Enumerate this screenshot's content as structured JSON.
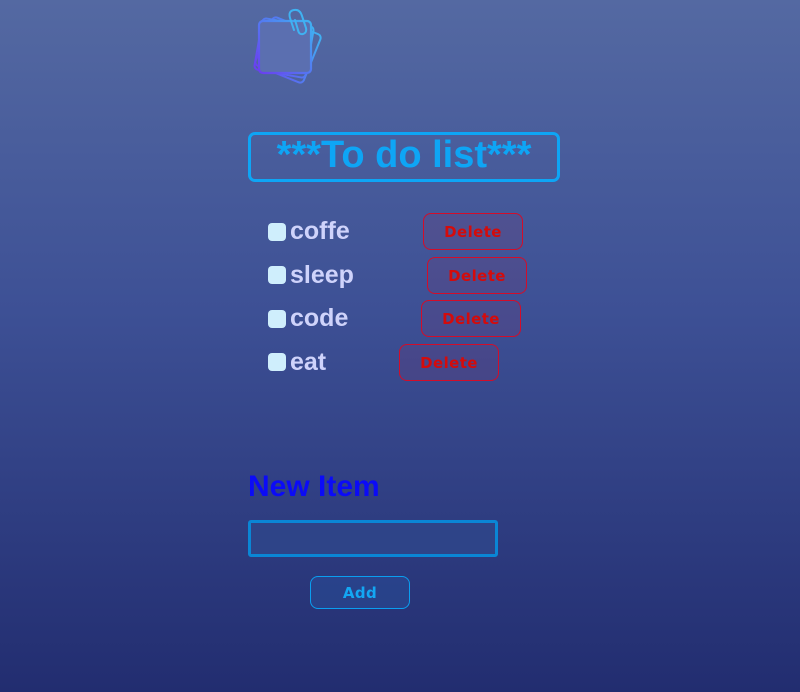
{
  "title": "***To do list***",
  "icons": {
    "logo": "sticky-notes-with-paperclip-icon",
    "checkbox": "checkbox-square"
  },
  "todo": {
    "items": [
      {
        "label": "coffe",
        "delete_label": "Delete"
      },
      {
        "label": "sleep",
        "delete_label": "Delete"
      },
      {
        "label": "code",
        "delete_label": "Delete"
      },
      {
        "label": "eat",
        "delete_label": "Delete"
      }
    ]
  },
  "new_item": {
    "heading": "New Item",
    "input_value": "",
    "add_label": "Add"
  },
  "colors": {
    "accent": "#0ea5f5",
    "item_text": "#cfd3fb",
    "delete": "#d50b0b",
    "heading": "#0b0bf7"
  }
}
